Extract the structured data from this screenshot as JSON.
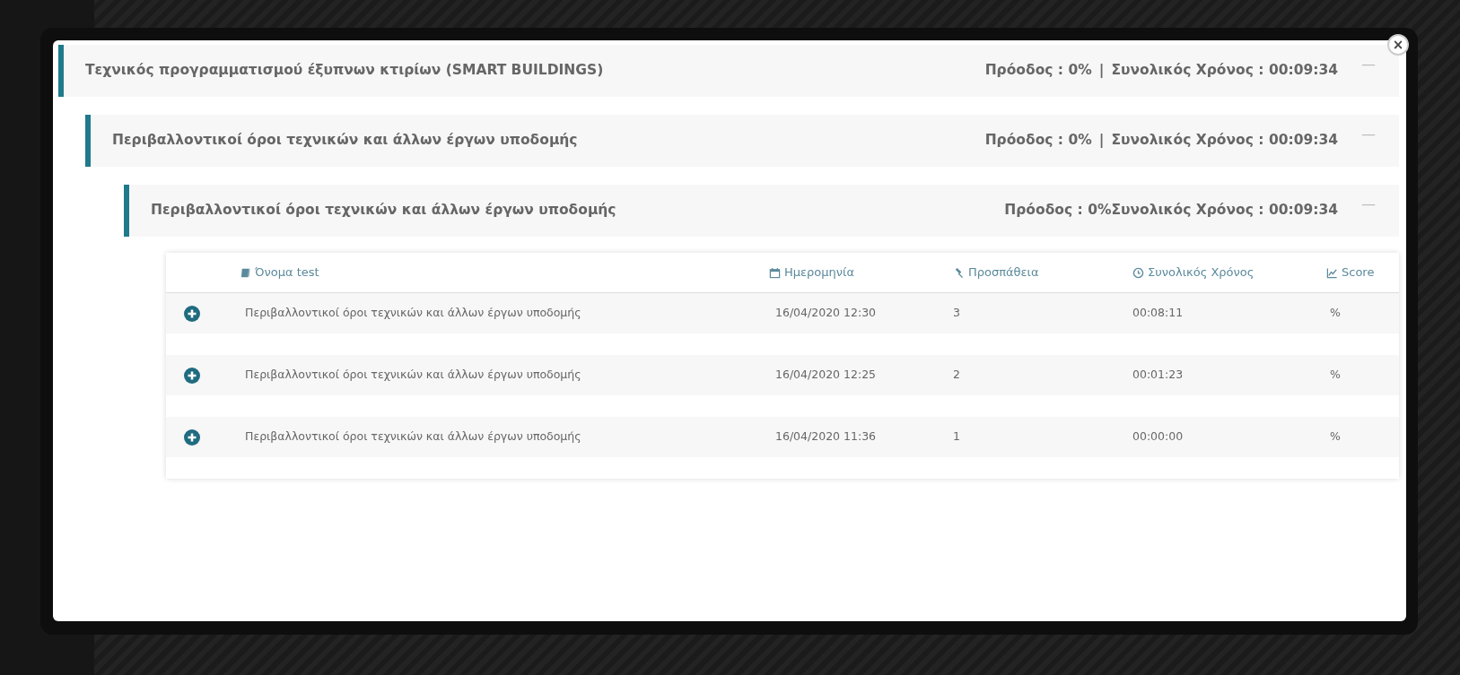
{
  "modal": {
    "close_label": "×",
    "sections": [
      {
        "title": "Τεχνικός προγραμματισμού έξυπνων κτιρίων (SMART BUILDINGS)",
        "progress": "Πρόοδος : 0%",
        "separator": "|",
        "time": "Συνολικός Χρόνος : 00:09:34",
        "collapse_label": "—",
        "expanded": true,
        "children": [
          {
            "title": "Περιβαλλοντικοί όροι τεχνικών και άλλων έργων υποδομής",
            "progress": "Πρόοδος : 0%",
            "separator": "|",
            "time": "Συνολικός Χρόνος : 00:09:34",
            "collapse_label": "—",
            "expanded": true,
            "children": [
              {
                "title": "Περιβαλλοντικοί όροι τεχνικών και άλλων έργων υποδομής",
                "progress": "Πρόοδος : 0%",
                "time": "Συνολικός Χρόνος : 00:09:34",
                "collapse_label": "—",
                "expanded": true,
                "table": {
                  "columns": [
                    {
                      "label": "Όνομα test"
                    },
                    {
                      "label": "Ημερομηνία"
                    },
                    {
                      "label": "Προσπάθεια"
                    },
                    {
                      "label": "Συνολικός Χρόνος"
                    },
                    {
                      "label": "Score"
                    }
                  ],
                  "rows": [
                    {
                      "name": "Περιβαλλοντικοί όροι τεχνικών και άλλων έργων υποδομής",
                      "date": "16/04/2020 12:30",
                      "attempt": "3",
                      "time": "00:08:11",
                      "score": "%"
                    },
                    {
                      "name": "Περιβαλλοντικοί όροι τεχνικών και άλλων έργων υποδομής",
                      "date": "16/04/2020 12:25",
                      "attempt": "2",
                      "time": "00:01:23",
                      "score": "%"
                    },
                    {
                      "name": "Περιβαλλοντικοί όροι τεχνικών και άλλων έργων υποδομής",
                      "date": "16/04/2020 11:36",
                      "attempt": "1",
                      "time": "00:00:00",
                      "score": "%"
                    }
                  ]
                }
              }
            ]
          }
        ]
      }
    ]
  }
}
